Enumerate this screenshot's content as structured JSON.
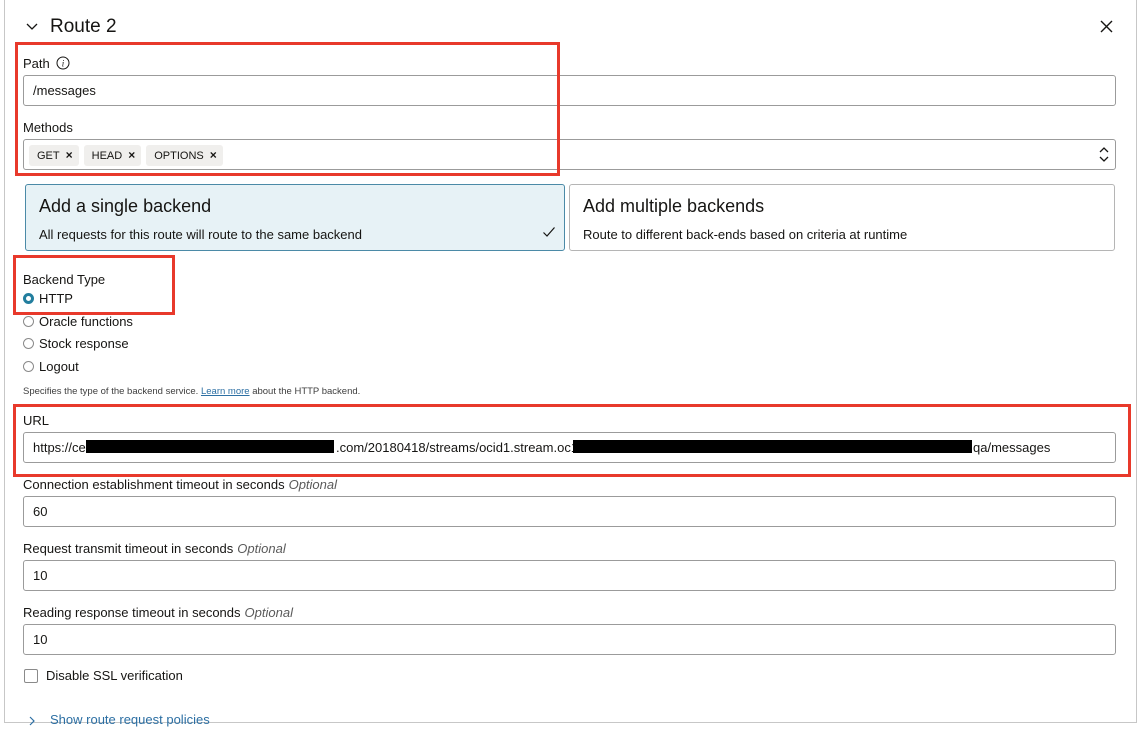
{
  "header": {
    "title": "Route 2",
    "collapse_icon": "chevron-down-icon",
    "close_icon": "close-icon"
  },
  "path": {
    "label": "Path",
    "info_icon": "info-icon",
    "value": "/messages"
  },
  "methods": {
    "label": "Methods",
    "chips": [
      "GET",
      "HEAD",
      "OPTIONS"
    ],
    "remove_glyph": "×"
  },
  "backend_mode": {
    "single": {
      "title": "Add a single backend",
      "desc": "All requests for this route will route to the same backend",
      "selected": true
    },
    "multiple": {
      "title": "Add multiple backends",
      "desc": "Route to different back-ends based on criteria at runtime",
      "selected": false
    }
  },
  "backend_type": {
    "label": "Backend Type",
    "options": [
      "HTTP",
      "Oracle functions",
      "Stock response",
      "Logout"
    ],
    "selected": "HTTP",
    "help_prefix": "Specifies the type of the backend service.",
    "help_link": "Learn more",
    "help_suffix": "about the HTTP backend."
  },
  "url": {
    "label": "URL",
    "part1": "https://ce",
    "part2": ".com/20180418/streams/ocid1.stream.oc1",
    "part3": "qa/messages"
  },
  "timeouts": {
    "optional": "Optional",
    "connect": {
      "label": "Connection establishment timeout in seconds",
      "value": "60"
    },
    "transmit": {
      "label": "Request transmit timeout in seconds",
      "value": "10"
    },
    "read": {
      "label": "Reading response timeout in seconds",
      "value": "10"
    }
  },
  "ssl": {
    "label": "Disable SSL verification",
    "checked": false
  },
  "policies_link": "Show route request policies",
  "colors": {
    "accent": "#227e9e",
    "highlight": "#e8392b",
    "selected_card_bg": "#e7f2f6"
  }
}
